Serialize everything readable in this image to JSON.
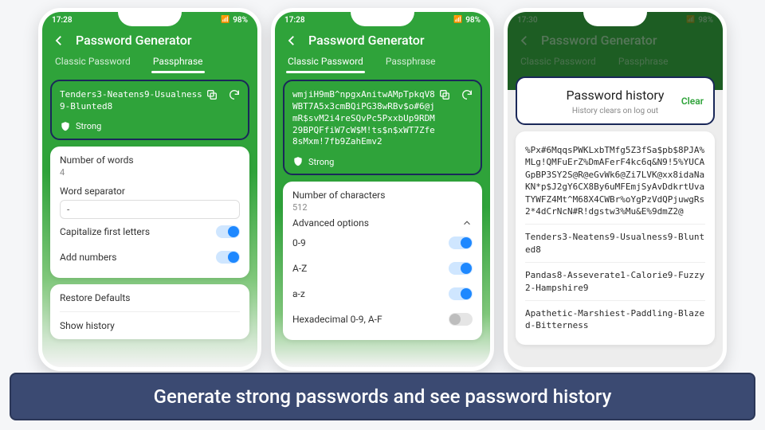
{
  "caption": "Generate strong passwords and see password history",
  "phone1": {
    "time": "17:28",
    "battery": "98%",
    "app_title": "Password Generator",
    "tabs": {
      "classic": "Classic Password",
      "passphrase": "Passphrase"
    },
    "password": "Tenders3-Neatens9-Usualness9-Blunted8",
    "strength": "Strong",
    "num_words_label": "Number of words",
    "num_words_value": "4",
    "separator_label": "Word separator",
    "separator_value": "-",
    "cap_label": "Capitalize first letters",
    "nums_label": "Add numbers",
    "restore": "Restore Defaults",
    "show_history": "Show history"
  },
  "phone2": {
    "time": "17:28",
    "battery": "98%",
    "app_title": "Password Generator",
    "tabs": {
      "classic": "Classic Password",
      "passphrase": "Passphrase"
    },
    "password": "wmjiH9mB^npgxAnitwAMpTpkqV8WBT7A5x3cmBQiPG38wRBv$o#6@jmR$svM2i4reSQvPc5PxxbUp9RDM29BPQFfiW7cW$M!ts$n$xWT7Zfe8sMxm!7fb9ZahEmv2",
    "strength": "Strong",
    "num_chars_label": "Number of characters",
    "num_chars_value": "512",
    "advanced_label": "Advanced options",
    "opt_09": "0-9",
    "opt_AZ": "A-Z",
    "opt_az": "a-z",
    "opt_hex": "Hexadecimal 0-9, A-F"
  },
  "phone3": {
    "time": "17:30",
    "battery": "98%",
    "app_title": "Password Generator",
    "tabs": {
      "classic": "Classic Password",
      "passphrase": "Passphrase"
    },
    "history_title": "Password history",
    "history_sub": "History clears on log out",
    "clear": "Clear",
    "items": [
      "%Px#6MqqsPWKLxbTMfg5Z3fSa$pb$8PJA%MLg!QMFuErZ%DmAFerF4kc6q&N9!5%YUCAGpBP3SY2S@R@eGvWk6@Zi7LVK@xx8idaNaKN*p$J2gY6CX8By6uMFEmjSyAvDdkrtUvaTYWFZ4Mt^M68X4CWBr%oYgPzVdQPjuwgRs2*4dCrNcN#R!dgstw3%Mu&E%9dmZ2@",
      "Tenders3-Neatens9-Usualness9-Blunted8",
      "Pandas8-Asseverate1-Calorie9-Fuzzy2-Hampshire9",
      "Apathetic-Marshiest-Paddling-Blazed-Bitterness"
    ]
  }
}
